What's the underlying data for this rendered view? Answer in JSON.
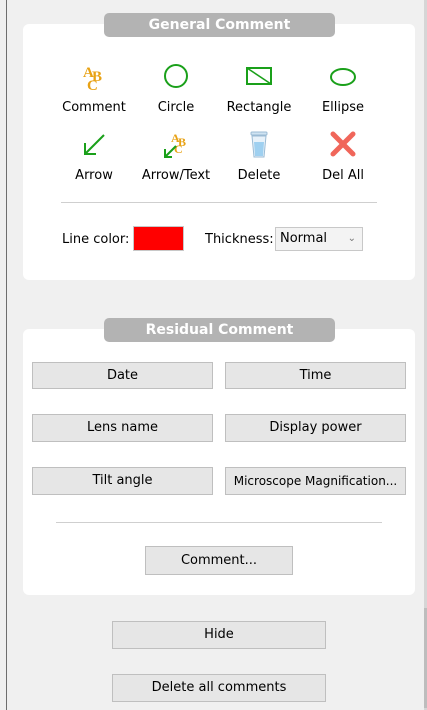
{
  "general": {
    "title": "General Comment",
    "tools": [
      {
        "label": "Comment",
        "icon": "abc-text-icon"
      },
      {
        "label": "Circle",
        "icon": "circle-icon"
      },
      {
        "label": "Rectangle",
        "icon": "rectangle-icon"
      },
      {
        "label": "Ellipse",
        "icon": "ellipse-icon"
      },
      {
        "label": "Arrow",
        "icon": "arrow-icon"
      },
      {
        "label": "Arrow/Text",
        "icon": "arrow-text-icon"
      },
      {
        "label": "Delete",
        "icon": "trash-icon"
      },
      {
        "label": "Del All",
        "icon": "delete-all-icon"
      }
    ],
    "line_color_label": "Line color:",
    "line_color_value": "#ff0000",
    "thickness_label": "Thickness:",
    "thickness_value": "Normal"
  },
  "residual": {
    "title": "Residual Comment",
    "buttons": [
      "Date",
      "Time",
      "Lens name",
      "Display power",
      "Tilt angle",
      "Microscope Magnification..."
    ],
    "comment_button": "Comment..."
  },
  "footer": {
    "hide_button": "Hide",
    "delete_all_button": "Delete all comments"
  },
  "colors": {
    "icon_green": "#1aa01a",
    "icon_orange": "#e8a215",
    "icon_red": "#f0665a",
    "header_gray": "#b3b3b3"
  }
}
